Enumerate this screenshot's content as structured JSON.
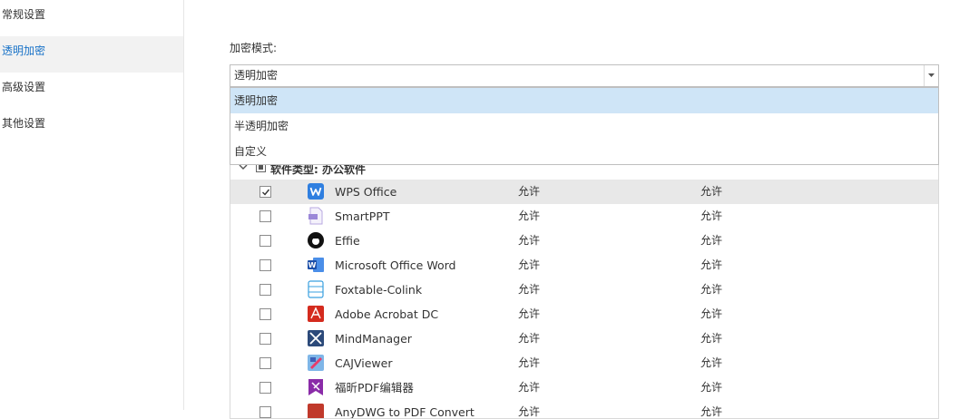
{
  "sidebar": {
    "items": [
      {
        "label": "常规设置"
      },
      {
        "label": "透明加密"
      },
      {
        "label": "高级设置"
      },
      {
        "label": "其他设置"
      }
    ]
  },
  "main": {
    "mode_label": "加密模式:",
    "select": {
      "value": "透明加密",
      "options": [
        "透明加密",
        "半透明加密",
        "自定义"
      ]
    },
    "group": {
      "label": "软件类型: 办公软件"
    },
    "rows": [
      {
        "name": "WPS Office",
        "col1": "允许",
        "col2": "允许",
        "checked": true,
        "icon": "wps-office-icon"
      },
      {
        "name": "SmartPPT",
        "col1": "允许",
        "col2": "允许",
        "checked": false,
        "icon": "smartppt-icon"
      },
      {
        "name": "Effie",
        "col1": "允许",
        "col2": "允许",
        "checked": false,
        "icon": "effie-icon"
      },
      {
        "name": "Microsoft Office Word",
        "col1": "允许",
        "col2": "允许",
        "checked": false,
        "icon": "word-icon"
      },
      {
        "name": "Foxtable-Colink",
        "col1": "允许",
        "col2": "允许",
        "checked": false,
        "icon": "foxtable-icon"
      },
      {
        "name": "Adobe Acrobat DC",
        "col1": "允许",
        "col2": "允许",
        "checked": false,
        "icon": "acrobat-icon"
      },
      {
        "name": "MindManager",
        "col1": "允许",
        "col2": "允许",
        "checked": false,
        "icon": "mindmanager-icon"
      },
      {
        "name": "CAJViewer",
        "col1": "允许",
        "col2": "允许",
        "checked": false,
        "icon": "cajviewer-icon"
      },
      {
        "name": "福昕PDF编辑器",
        "col1": "允许",
        "col2": "允许",
        "checked": false,
        "icon": "foxit-pdf-icon"
      },
      {
        "name": "AnyDWG to PDF Convert",
        "col1": "允许",
        "col2": "允许",
        "checked": false,
        "icon": "dwg-icon"
      }
    ]
  },
  "colors": {
    "accent": "#1a73c8",
    "selected_option": "#cfe5f7",
    "row_highlight": "#e8e8e8"
  }
}
